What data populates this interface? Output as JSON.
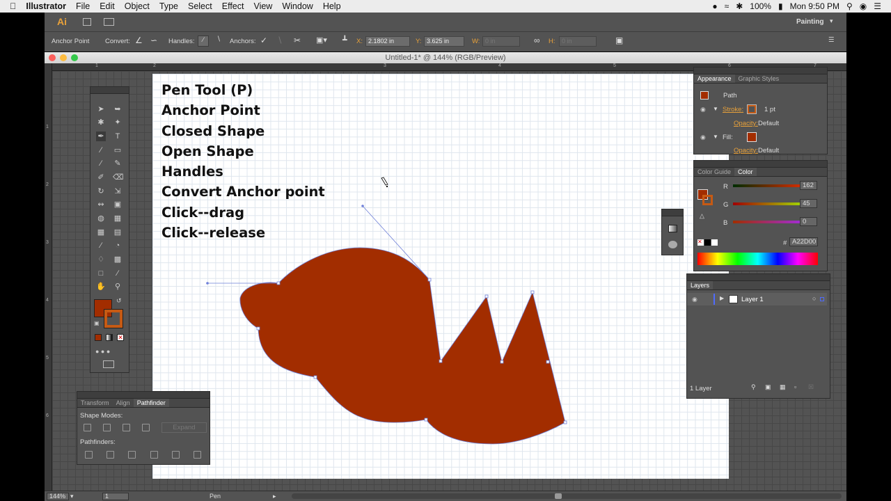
{
  "menubar": {
    "apple": "",
    "app": "Illustrator",
    "menus": [
      "File",
      "Edit",
      "Object",
      "Type",
      "Select",
      "Effect",
      "View",
      "Window",
      "Help"
    ],
    "battery": "100%",
    "clock": "Mon 9:50 PM"
  },
  "appbar": {
    "logo": "Ai",
    "workspace": "Painting"
  },
  "control": {
    "mode": "Anchor Point",
    "convert": "Convert:",
    "handles": "Handles:",
    "anchors": "Anchors:",
    "x_label": "X:",
    "x_value": "2.1802 in",
    "y_label": "Y:",
    "y_value": "3.625 in",
    "w_label": "W:",
    "w_value": "0 in",
    "h_label": "H:",
    "h_value": "0 in"
  },
  "document": {
    "title": "Untitled-1* @ 144% (RGB/Preview)"
  },
  "ruler": {
    "top": [
      "1",
      "2",
      "3",
      "4",
      "5",
      "6",
      "7"
    ],
    "left": [
      "1",
      "2",
      "3",
      "4",
      "5",
      "6"
    ]
  },
  "notes": [
    "Pen Tool (P)",
    "Anchor Point",
    "Closed Shape",
    "Open Shape",
    "Handles",
    "Convert Anchor point",
    "Click--drag",
    "Click--release"
  ],
  "appearance": {
    "tabs": [
      "Appearance",
      "Graphic Styles"
    ],
    "object": "Path",
    "stroke_label": "Stroke:",
    "stroke_value": "1 pt",
    "opacity_label": "Opacity:",
    "opacity_value": "Default",
    "fill_label": "Fill:",
    "opacity2_label": "Opacity:",
    "opacity2_value": "Default"
  },
  "color": {
    "tabs": [
      "Color Guide",
      "Color"
    ],
    "r_label": "R",
    "r_value": "162",
    "g_label": "G",
    "g_value": "45",
    "b_label": "B",
    "b_value": "0",
    "hex_label": "#",
    "hex_value": "A22D00",
    "fill_color": "#a22d00"
  },
  "layers": {
    "title": "Layers",
    "layer_name": "Layer 1",
    "count": "1 Layer"
  },
  "pathfinder": {
    "tabs": [
      "Transform",
      "Align",
      "Pathfinder"
    ],
    "shape_modes": "Shape Modes:",
    "expand": "Expand",
    "pathfinders": "Pathfinders:"
  },
  "status": {
    "zoom": "144%",
    "artboard": "1",
    "tool": "Pen"
  }
}
